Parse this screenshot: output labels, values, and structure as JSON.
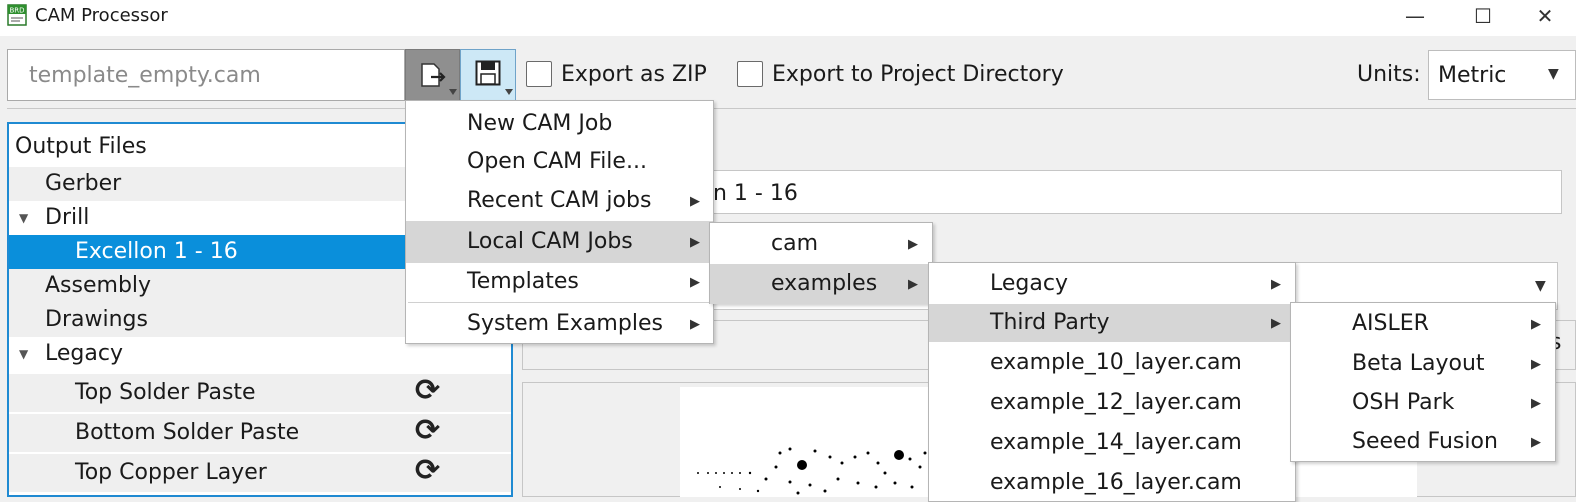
{
  "window": {
    "title": "CAM Processor",
    "app_icon_text": "BRD",
    "minimize_glyph": "—",
    "maximize_glyph": "☐",
    "close_glyph": "✕"
  },
  "toolbar": {
    "template_placeholder": "template_empty.cam",
    "export_zip_label": "Export as ZIP",
    "export_zip_checked": false,
    "export_project_label": "Export to Project Directory",
    "export_project_checked": false,
    "units_label": "Units:",
    "units_value": "Metric",
    "units_options": [
      "Metric"
    ]
  },
  "tree": {
    "header": "Output Files",
    "items": [
      {
        "label": "Gerber"
      },
      {
        "label": "Drill"
      },
      {
        "label": "Excellon 1 - 16"
      },
      {
        "label": "Assembly"
      },
      {
        "label": "Drawings"
      },
      {
        "label": "Legacy"
      },
      {
        "label": "Top Solder Paste"
      },
      {
        "label": "Bottom Solder Paste"
      },
      {
        "label": "Top Copper Layer"
      }
    ]
  },
  "right": {
    "name_value": "Excellon 1 - 16",
    "visible_name_fragment": "n 1 - 16",
    "cut_label": "s"
  },
  "menus": {
    "load_menu": {
      "items": [
        {
          "label": "New CAM Job"
        },
        {
          "label": "Open CAM File..."
        },
        {
          "label": "Recent CAM jobs"
        },
        {
          "label": "Local CAM Jobs"
        },
        {
          "label": "Templates"
        },
        {
          "label": "System Examples"
        }
      ]
    },
    "local_cam_jobs": {
      "items": [
        {
          "label": "cam"
        },
        {
          "label": "examples"
        }
      ]
    },
    "examples": {
      "items": [
        {
          "label": "Legacy"
        },
        {
          "label": "Third Party"
        },
        {
          "label": "example_10_layer.cam"
        },
        {
          "label": "example_12_layer.cam"
        },
        {
          "label": "example_14_layer.cam"
        },
        {
          "label": "example_16_layer.cam"
        }
      ]
    },
    "third_party": {
      "items": [
        {
          "label": "AISLER"
        },
        {
          "label": "Beta Layout"
        },
        {
          "label": "OSH Park"
        },
        {
          "label": "Seeed Fusion"
        }
      ]
    },
    "submenu_arrow": "▶"
  },
  "icons": {
    "tree_expanded": "▼",
    "combo_arrow": "▼",
    "refresh": "⟳"
  },
  "colors": {
    "selection": "#0a8fdb",
    "panel_border": "#1f8ad2",
    "menu_highlight": "#d6d6d6",
    "save_button_bg": "#cde8f6"
  }
}
